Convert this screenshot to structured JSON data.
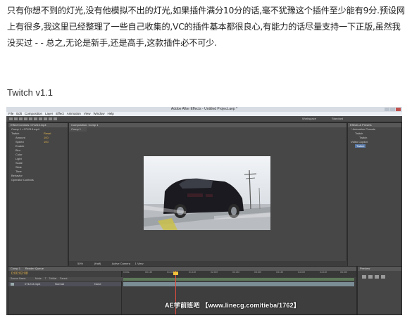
{
  "article": {
    "paragraph": "只有你想不到的灯光,没有他模拟不出的灯光,如果插件满分10分的话,毫不犹豫这个插件至少能有9分.预设网上有很多,我这里已经整理了一些自己收集的,VC的插件基本都很良心,有能力的话尽量支持一下正版,虽然我没买过 - - 总之,无论是新手,还是高手,这款插件必不可少.",
    "heading": "Twitch v1.1"
  },
  "screenshot": {
    "window_title": "Adobe After Effects - Untitled Project.aep *",
    "menu": [
      "File",
      "Edit",
      "Composition",
      "Layer",
      "Effect",
      "Animation",
      "View",
      "Window",
      "Help"
    ],
    "workspace_label": "Workspace",
    "workspace_value": "Standard",
    "effect_controls_tab": "Effect Controls: 071213.mp4",
    "effect_controls_sub": "Comp 1 • 071213.mp4",
    "effect_rows": [
      {
        "label": "Twitch",
        "value": "Reset"
      },
      {
        "label": "Amount",
        "value": "100"
      },
      {
        "label": "Speed",
        "value": "100"
      },
      {
        "label": "Enable",
        "value": ""
      },
      {
        "label": "Blur",
        "value": ""
      },
      {
        "label": "Color",
        "value": ""
      },
      {
        "label": "Light",
        "value": ""
      },
      {
        "label": "Scale",
        "value": ""
      },
      {
        "label": "Slide",
        "value": ""
      },
      {
        "label": "Time",
        "value": ""
      },
      {
        "label": "Behavior",
        "value": ""
      },
      {
        "label": "Operator Controls",
        "value": ""
      }
    ],
    "comp_tab": "Composition: Comp 1",
    "comp_tab_name": "Comp 1",
    "view_zoom": "50%",
    "view_res": "(Half)",
    "view_camera": "Active Camera",
    "view_views": "1 View",
    "right_tab": "Effects & Presets",
    "right_rows": [
      "* Animation Presets",
      "Twitch",
      "Twitch",
      "Video Copilot",
      "Twitch"
    ],
    "timeline_tab": "Comp 1",
    "render_tab": "Render Queue",
    "timecode": "0:00:02:08",
    "column_headers": [
      "Source Name",
      "Mode",
      "T",
      "TrkMat",
      "Parent"
    ],
    "layer_name": "071213.mp4",
    "layer_mode": "Normal",
    "layer_parent": "None",
    "ruler_ticks": [
      "0:00s",
      "00:15f",
      "01:00f",
      "01:15f",
      "02:00f",
      "02:15f",
      "03:00f",
      "03:15f",
      "04:00f",
      "04:15f",
      "05:00f"
    ],
    "preview_tab": "Preview",
    "watermark": "AE学前班吧 【www.linecg.com/tieba/1762】"
  },
  "colors": {
    "ae_panel": "#464646",
    "timecode": "#e3b14b",
    "playhead": "#e04d3f"
  }
}
